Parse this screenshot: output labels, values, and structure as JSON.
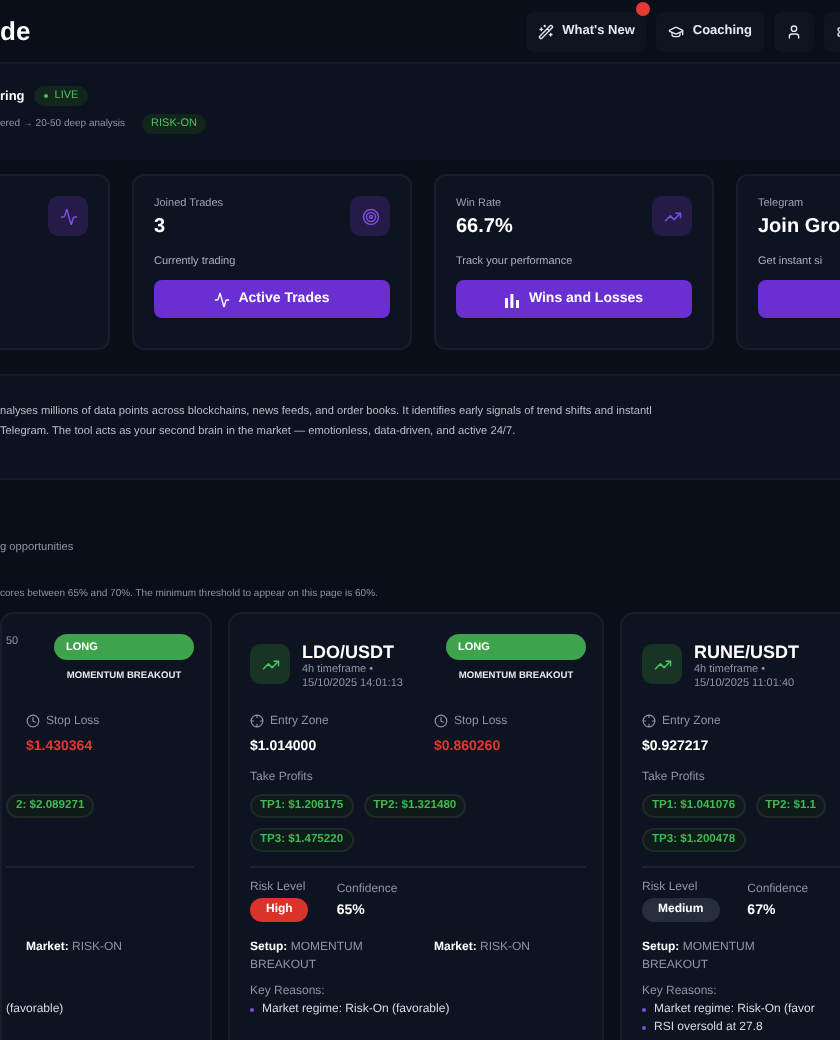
{
  "header": {
    "logo": "de",
    "actions": [
      {
        "kind": "whats-new",
        "label": "What's New",
        "badge": true
      },
      {
        "kind": "coaching",
        "label": "Coaching",
        "badge": false
      },
      {
        "kind": "user",
        "badge": false
      },
      {
        "kind": "settings",
        "badge": false
      }
    ]
  },
  "status": {
    "title": "ring",
    "live": "LIVE",
    "subtitle": "ered → 20-50 deep analysis",
    "regime": "RISK-ON"
  },
  "stats": [
    {
      "kind": "activity"
    },
    {
      "kind": "joined",
      "label": "Joined Trades",
      "value": "3",
      "caption": "Currently trading",
      "button": "Active Trades"
    },
    {
      "kind": "winrate",
      "label": "Win Rate",
      "value": "66.7%",
      "caption": "Track your performance",
      "button": "Wins and Losses"
    },
    {
      "kind": "telegram",
      "label": "Telegram",
      "value": "Join Gro",
      "caption": "Get instant si"
    }
  ],
  "about": {
    "lines": [
      "nalyses millions of data points across blockchains, news feeds, and order books. It identifies early signals of trend shifts and instantl",
      "Telegram. The tool acts as your second brain in the market — emotionless, data-driven, and active 24/7."
    ]
  },
  "signals": {
    "subtitle": "g opportunities",
    "note": "cores between 65% and 70%. The minimum threshold to appear on this page is 60%.",
    "cards": [
      {
        "time": "50",
        "direction": "LONG",
        "setup_tag": "MOMENTUM BREAKOUT",
        "stop_label": "Stop Loss",
        "stop": "$1.430364",
        "tps": [
          "2: $2.089271"
        ],
        "market_label": "Market:",
        "market": "RISK-ON",
        "reasons": [
          {
            "text": "(favorable)",
            "bullet": false
          }
        ]
      },
      {
        "pair": "LDO/USDT",
        "timeframe": "4h timeframe •",
        "time": "15/10/2025 14:01:13",
        "direction": "LONG",
        "setup_tag": "MOMENTUM BREAKOUT",
        "entry_label": "Entry Zone",
        "entry": "$1.014000",
        "stop_label": "Stop Loss",
        "stop": "$0.860260",
        "tp_label": "Take Profits",
        "tps": [
          "TP1: $1.206175",
          "TP2: $1.321480",
          "TP3: $1.475220"
        ],
        "risk_label": "Risk Level",
        "risk": {
          "label": "High",
          "color": "#d9342b"
        },
        "confidence_label": "Confidence",
        "confidence": "65%",
        "setup_label": "Setup:",
        "setup": "MOMENTUM BREAKOUT",
        "market_label": "Market:",
        "market": "RISK-ON",
        "reasons_label": "Key Reasons:",
        "reasons": [
          {
            "text": "Market regime: Risk-On (favorable)",
            "bullet": true
          }
        ]
      },
      {
        "pair": "RUNE/USDT",
        "timeframe": "4h timeframe •",
        "time": "15/10/2025 11:01:40",
        "entry_label": "Entry Zone",
        "entry": "$0.927217",
        "tp_label": "Take Profits",
        "tps": [
          "TP1: $1.041076",
          "TP2: $1.1",
          "TP3: $1.200478"
        ],
        "risk_label": "Risk Level",
        "risk": {
          "label": "Medium",
          "color": "#262d3d"
        },
        "confidence_label": "Confidence",
        "confidence": "67%",
        "setup_label": "Setup:",
        "setup": "MOMENTUM BREAKOUT",
        "reasons_label": "Key Reasons:",
        "reasons": [
          {
            "text": "Market regime: Risk-On (favor",
            "bullet": true
          },
          {
            "text": "RSI oversold at 27.8",
            "bullet": true
          }
        ]
      }
    ]
  }
}
